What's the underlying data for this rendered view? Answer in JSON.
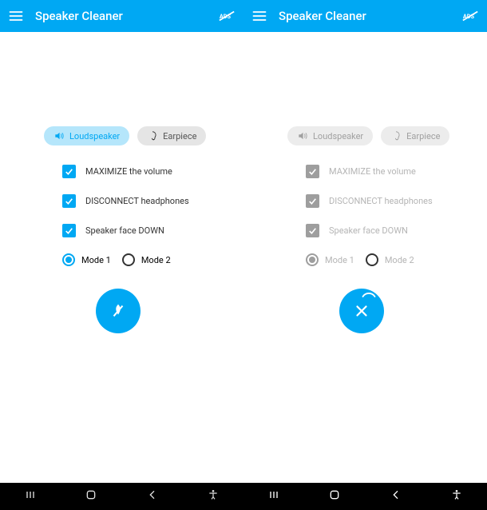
{
  "header": {
    "title": "Speaker Cleaner"
  },
  "pills": {
    "loudspeaker": "Loudspeaker",
    "earpiece": "Earpiece"
  },
  "checks": {
    "maximize": "MAXIMIZE the volume",
    "disconnect": "DISCONNECT headphones",
    "facedown": "Speaker face DOWN"
  },
  "modes": {
    "mode1": "Mode 1",
    "mode2": "Mode 2"
  },
  "colors": {
    "accent": "#00a8f3"
  }
}
